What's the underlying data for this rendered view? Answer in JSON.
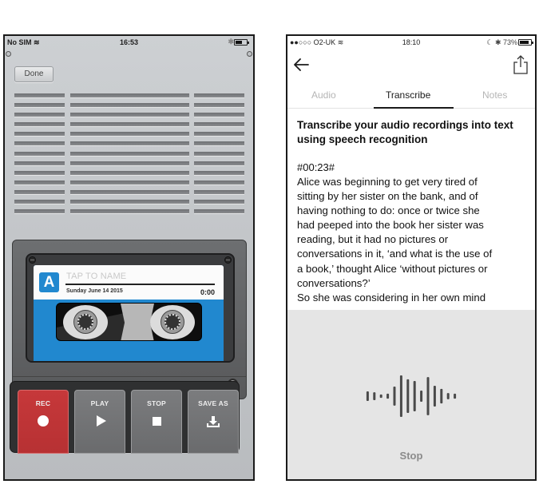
{
  "left_phone": {
    "status_bar": {
      "carrier": "No SIM",
      "time": "16:53",
      "bluetooth": "bluetooth-icon",
      "battery_level": 0.55
    },
    "done_label": "Done",
    "cassette": {
      "badge_letter": "A",
      "name_placeholder": "TAP TO NAME",
      "date": "Sunday June 14 2015",
      "duration": "0:00"
    },
    "controls": [
      {
        "label": "REC",
        "icon": "record-icon"
      },
      {
        "label": "PLAY",
        "icon": "play-icon"
      },
      {
        "label": "STOP",
        "icon": "stop-icon"
      },
      {
        "label": "SAVE AS",
        "icon": "download-icon"
      }
    ],
    "colors": {
      "tape_blue": "#2188cf",
      "rec_red": "#c6383a"
    }
  },
  "right_phone": {
    "status_bar": {
      "carrier": "●●○○○ O2-UK",
      "time": "18:10",
      "right": "☾ ✱ 73%",
      "battery_level": 0.73
    },
    "tabs": [
      {
        "label": "Audio",
        "active": false
      },
      {
        "label": "Transcribe",
        "active": true
      },
      {
        "label": "Notes",
        "active": false
      }
    ],
    "heading": "Transcribe your audio recordings into text using speech recognition",
    "timestamp": "#00:23#",
    "transcript_lines": [
      "Alice was beginning to get very tired of",
      "sitting by her sister on the bank, and of",
      "having nothing to do: once or twice she",
      "had peeped into the book her sister was",
      "reading, but it had no pictures or",
      "conversations in it, ‘and what is the use of",
      "a book,’ thought Alice ‘without pictures or",
      "conversations?’",
      "So she was considering in her own mind"
    ],
    "waveform_levels": [
      0.23,
      0.19,
      0.08,
      0.12,
      0.46,
      1.0,
      0.81,
      0.73,
      0.27,
      0.92,
      0.5,
      0.35,
      0.15,
      0.12
    ],
    "stop_label": "Stop"
  }
}
